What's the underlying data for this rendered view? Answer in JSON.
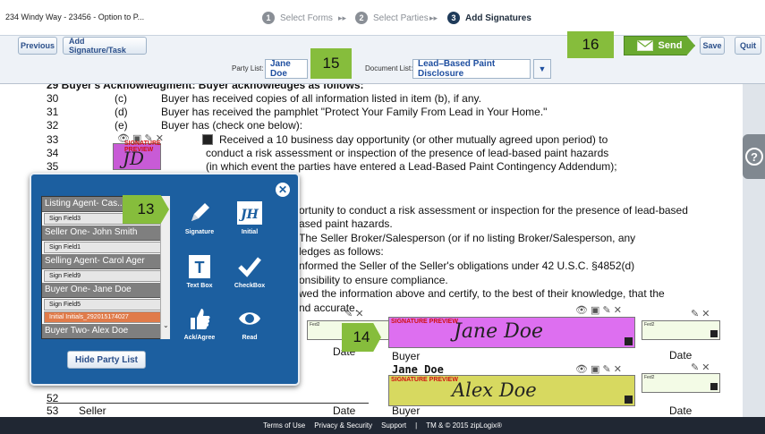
{
  "window": {
    "doc_title": "234 Windy Way - 23456 - Option to P..."
  },
  "steps": [
    {
      "num": "1",
      "label": "Select Forms"
    },
    {
      "num": "2",
      "label": "Select Parties"
    },
    {
      "num": "3",
      "label": "Add Signatures"
    }
  ],
  "step_sep": "▸▸",
  "toolbar": {
    "previous": "Previous",
    "add_signature": "Add Signature/Task",
    "party_list_label": "Party List:",
    "party_list_value": "Jane Doe",
    "document_list_label": "Document List:",
    "document_list_value": "Lead–Based Paint Disclosure",
    "send": "Send",
    "save": "Save",
    "quit": "Quit"
  },
  "badges": {
    "b13": "13",
    "b14": "14",
    "b15": "15",
    "b16": "16"
  },
  "document": {
    "header_line": "29    Buyer's Acknowledgment: Buyer acknowledges as follows:",
    "lines": [
      {
        "num": "30",
        "item": "(c)",
        "text": "Buyer has received copies of all information listed in item (b), if any."
      },
      {
        "num": "31",
        "item": "(d)",
        "text": "Buyer has received the pamphlet \"Protect Your Family From Lead in Your Home.\""
      },
      {
        "num": "32",
        "item": "(e)",
        "text": "Buyer has (check one below):"
      },
      {
        "num": "33",
        "item": "",
        "text": "Received a 10 business day opportunity (or other mutually agreed upon period) to"
      },
      {
        "num": "34",
        "item": "",
        "text": "conduct a risk assessment or inspection of the presence of lead-based paint hazards"
      },
      {
        "num": "35",
        "item": "",
        "text": "(in which event the parties have entered a Lead-Based Paint Contingency Addendum);"
      }
    ],
    "partial_lines": [
      "ortunity to conduct a risk assessment or inspection for the presence of lead-based",
      "ased paint hazards.",
      "The  Seller  Broker/Salesperson  (or  if  no  listing  Broker/Salesperson,  any",
      "ledges as follows:",
      "nformed the Seller of the Seller's obligations under 42 U.S.C. §4852(d)",
      "onsibility to ensure compliance.",
      "wed the information above and certify, to the best of their knowledge, that the",
      "nd accurate."
    ],
    "sig_preview_label": "SIGNATURE PREVIEW",
    "jane_signature": "Jane Doe",
    "alex_signature": "Alex Doe",
    "initials_value": "JD",
    "date_label": "Date",
    "buyer_label": "Buyer",
    "buyer_name": "Jane Doe",
    "seller_label": "Seller",
    "line_52": "52",
    "line_53": "53",
    "field_tag": "Fed2"
  },
  "party_panel": {
    "groups": [
      {
        "label": "Listing Agent- Cas... Davis",
        "fields": [
          "Sign Field3"
        ]
      },
      {
        "label": "Seller One- John Smith",
        "fields": [
          "Sign Field1"
        ]
      },
      {
        "label": "Selling Agent- Carol Ager",
        "fields": [
          "Sign Field9"
        ]
      },
      {
        "label": "Buyer One- Jane Doe",
        "fields": [
          "Sign Field5",
          "Initial Initials_292015174027"
        ]
      },
      {
        "label": "Buyer Two- Alex Doe",
        "fields": []
      }
    ],
    "tools": [
      {
        "label": "Signature",
        "icon": "pen-icon"
      },
      {
        "label": "Initial",
        "icon": "initial-icon"
      },
      {
        "label": "Text Box",
        "icon": "textbox-icon"
      },
      {
        "label": "CheckBox",
        "icon": "checkmark-icon"
      },
      {
        "label": "Ack/Agree",
        "icon": "thumbs-up-icon"
      },
      {
        "label": "Read",
        "icon": "eye-icon"
      }
    ],
    "hide_button": "Hide Party List"
  },
  "footer": {
    "terms": "Terms of Use",
    "privacy": "Privacy & Security",
    "support": "Support",
    "sep": "|",
    "copyright": "TM & © 2015 zipLogix®"
  },
  "colors": {
    "accent_green": "#6aaa30",
    "badge_green": "#86bd3c",
    "panel_blue": "#1c5fa0",
    "magenta_sig": "#dd6ff0",
    "olive_sig": "#d7d960"
  }
}
